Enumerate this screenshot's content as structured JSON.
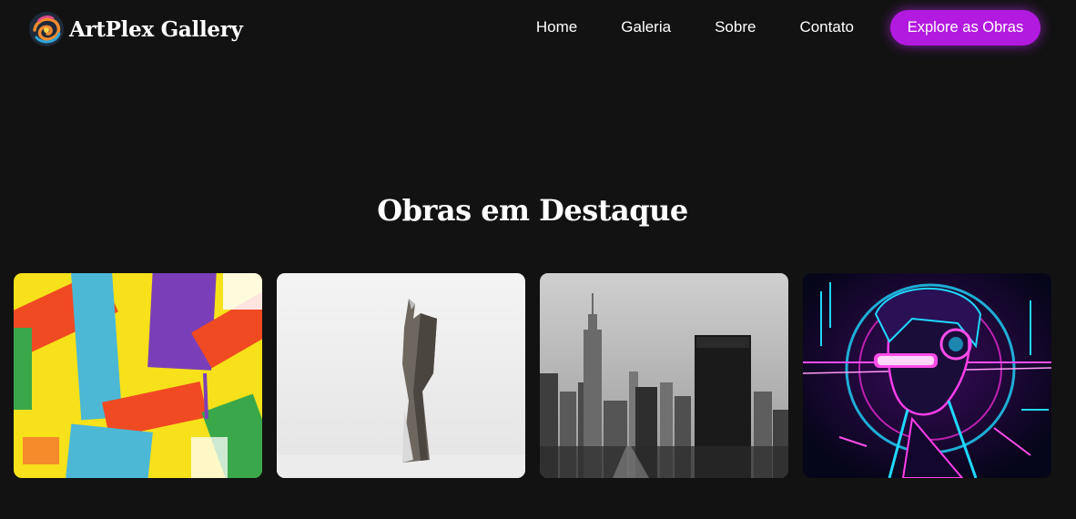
{
  "nav": {
    "brand_name": "ArtPlex Gallery",
    "logo_icon": "swirl-logo-icon",
    "links": [
      "Home",
      "Galeria",
      "Sobre",
      "Contato"
    ],
    "cta_label": "Explore as Obras",
    "accent_color": "#b31ae0"
  },
  "featured": {
    "title": "Obras em Destaque",
    "artworks": [
      {
        "image": "colorful-abstract-brushstrokes-painting"
      },
      {
        "image": "minimalist-metal-sculpture"
      },
      {
        "image": "black-and-white-city-skyline"
      },
      {
        "image": "neon-cyberpunk-portrait-with-headphones"
      }
    ]
  },
  "colors": {
    "background": "#121212",
    "text": "#ffffff"
  }
}
